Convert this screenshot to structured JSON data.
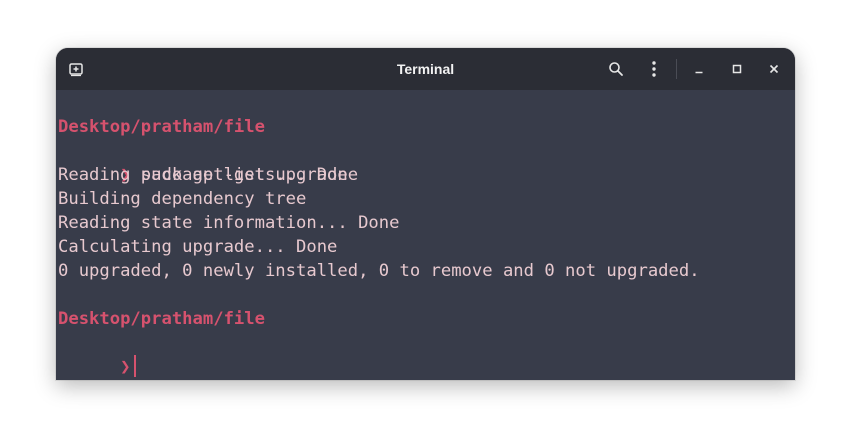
{
  "window": {
    "title": "Terminal"
  },
  "titlebar": {
    "new_tab_icon": "new-tab-icon",
    "search_icon": "search-icon",
    "menu_icon": "kebab-menu-icon",
    "minimize_icon": "minimize-icon",
    "maximize_icon": "maximize-icon",
    "close_icon": "close-icon"
  },
  "terminal": {
    "prompt_symbol": "❯",
    "lines": [
      {
        "type": "path",
        "text": "Desktop/pratham/file"
      },
      {
        "type": "command",
        "text": " sudo apt-get upgrade"
      },
      {
        "type": "output",
        "text": "Reading package lists... Done"
      },
      {
        "type": "output",
        "text": "Building dependency tree"
      },
      {
        "type": "output",
        "text": "Reading state information... Done"
      },
      {
        "type": "output",
        "text": "Calculating upgrade... Done"
      },
      {
        "type": "output",
        "text": "0 upgraded, 0 newly installed, 0 to remove and 0 not upgraded."
      },
      {
        "type": "path",
        "text": "Desktop/pratham/file"
      }
    ]
  },
  "colors": {
    "terminal_bg": "#383c4a",
    "titlebar_bg": "#2b2d35",
    "text": "#e7c9cf",
    "accent": "#d6526e"
  }
}
